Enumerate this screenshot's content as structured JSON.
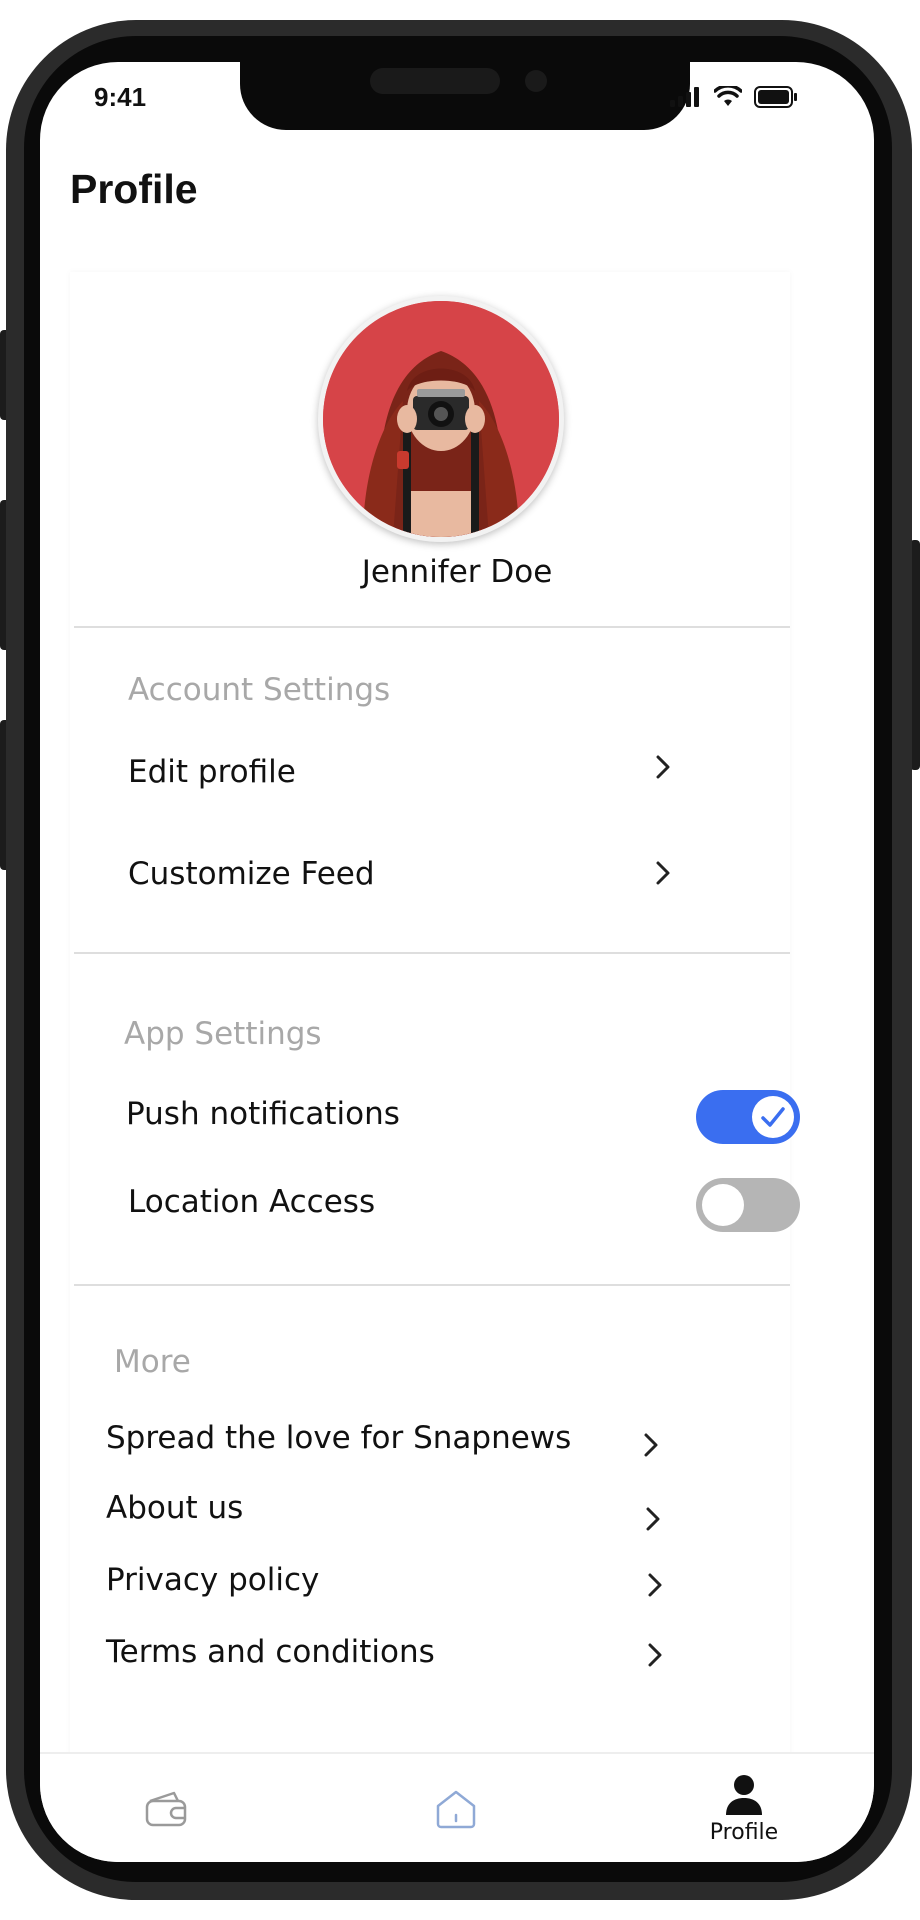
{
  "status_bar": {
    "time": "9:41"
  },
  "page": {
    "title": "Profile"
  },
  "profile": {
    "name": "Jennifer Doe"
  },
  "sections": {
    "account": {
      "title": "Account Settings",
      "items": [
        {
          "label": "Edit profile"
        },
        {
          "label": "Customize Feed"
        }
      ]
    },
    "app": {
      "title": "App Settings",
      "toggles": [
        {
          "label": "Push notifications",
          "on": true
        },
        {
          "label": "Location Access",
          "on": false
        }
      ]
    },
    "more": {
      "title": "More",
      "items": [
        {
          "label": "Spread the love for Snapnews"
        },
        {
          "label": "About us"
        },
        {
          "label": "Privacy policy"
        },
        {
          "label": "Terms and conditions"
        }
      ]
    }
  },
  "tabbar": {
    "tabs": [
      {
        "icon": "wallet-icon",
        "label": ""
      },
      {
        "icon": "home-icon",
        "label": ""
      },
      {
        "icon": "person-icon",
        "label": "Profile",
        "active": true
      }
    ]
  },
  "colors": {
    "accent": "#3a6ef0",
    "toggle_off": "#b5b5b5",
    "section_title": "#a8a8a8",
    "avatar_bg": "#d9464a"
  }
}
